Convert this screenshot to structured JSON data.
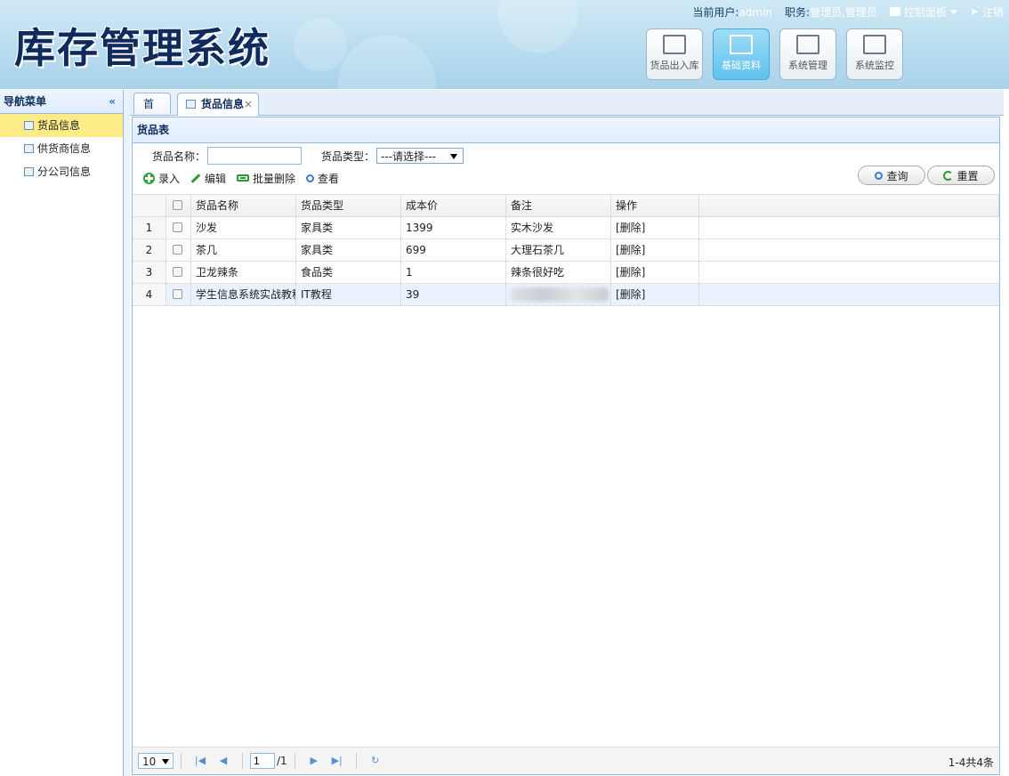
{
  "header": {
    "logo": "库存管理系统",
    "user_label": "当前用户:",
    "user_name": "admin",
    "role_label": "职务:",
    "role_value": "管理员,管理员",
    "control_panel": "控制面板",
    "logout": "注销",
    "nav_buttons": [
      {
        "label": "货品出入库"
      },
      {
        "label": "基础资料"
      },
      {
        "label": "系统管理"
      },
      {
        "label": "系统监控"
      }
    ]
  },
  "sidebar": {
    "title": "导航菜单",
    "collapse_icon": "«",
    "items": [
      {
        "label": "货品信息"
      },
      {
        "label": "供货商信息"
      },
      {
        "label": "分公司信息"
      }
    ]
  },
  "tabs": [
    {
      "label": "首页"
    },
    {
      "label": "货品信息"
    }
  ],
  "panel": {
    "title": "货品表",
    "search": {
      "name_label": "货品名称：",
      "name_value": "",
      "type_label": "货品类型：",
      "type_selected": "---请选择---"
    },
    "toolbar": {
      "add": "录入",
      "edit": "编辑",
      "batch_delete": "批量删除",
      "view": "查看"
    },
    "buttons": {
      "query": "查询",
      "reset": "重置"
    },
    "table": {
      "columns": [
        "货品名称",
        "货品类型",
        "成本价",
        "备注",
        "操作"
      ],
      "rows": [
        {
          "num": "1",
          "name": "沙发",
          "type": "家具类",
          "cost": "1399",
          "note": "实木沙发",
          "op": "[删除]"
        },
        {
          "num": "2",
          "name": "茶几",
          "type": "家具类",
          "cost": "699",
          "note": "大理石茶几",
          "op": "[删除]"
        },
        {
          "num": "3",
          "name": "卫龙辣条",
          "type": "食品类",
          "cost": "1",
          "note": "辣条很好吃",
          "op": "[删除]"
        },
        {
          "num": "4",
          "name": "学生信息系统实战教程",
          "type": "IT教程",
          "cost": "39",
          "note": "",
          "op": "[删除]"
        }
      ]
    },
    "pager": {
      "page_size": "10",
      "page": "1",
      "total_pages": "/1",
      "info": "1-4共4条"
    }
  }
}
